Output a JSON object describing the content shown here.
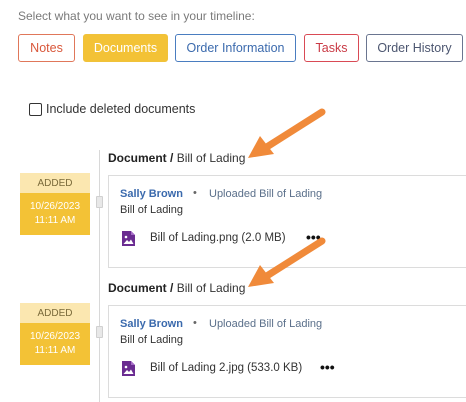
{
  "timeline": {
    "prompt": "Select what you want to see in your timeline:",
    "filters": [
      {
        "label": "Notes",
        "active": false,
        "color": "#d9573a"
      },
      {
        "label": "Documents",
        "active": true,
        "color": "#f3c236"
      },
      {
        "label": "Order Information",
        "active": false,
        "color": "#3b6aad"
      },
      {
        "label": "Tasks",
        "active": false,
        "color": "#c93a45"
      },
      {
        "label": "Order History",
        "active": false,
        "color": "#4c5670"
      }
    ],
    "include_deleted_label": "Include deleted documents",
    "include_deleted_checked": false
  },
  "entries": [
    {
      "title_prefix": "Document /",
      "title_suffix": "Bill of Lading",
      "status": "ADDED",
      "date": "10/26/2023",
      "time": "11:11 AM",
      "author": "Sally Brown",
      "separator": "•",
      "action": "Uploaded Bill of Lading",
      "subtitle": "Bill of Lading",
      "file_name": "Bill of Lading.png (2.0 MB)",
      "file_icon": "image-file-icon",
      "more": "•••"
    },
    {
      "title_prefix": "Document /",
      "title_suffix": "Bill of Lading",
      "status": "ADDED",
      "date": "10/26/2023",
      "time": "11:11 AM",
      "author": "Sally Brown",
      "separator": "•",
      "action": "Uploaded Bill of Lading",
      "subtitle": "Bill of Lading",
      "file_name": "Bill of Lading 2.jpg (533.0 KB)",
      "file_icon": "image-file-icon",
      "more": "•••"
    }
  ],
  "colors": {
    "accent": "#f3c236",
    "annotation_arrow": "#f08a3a",
    "link": "#3b6aad"
  }
}
